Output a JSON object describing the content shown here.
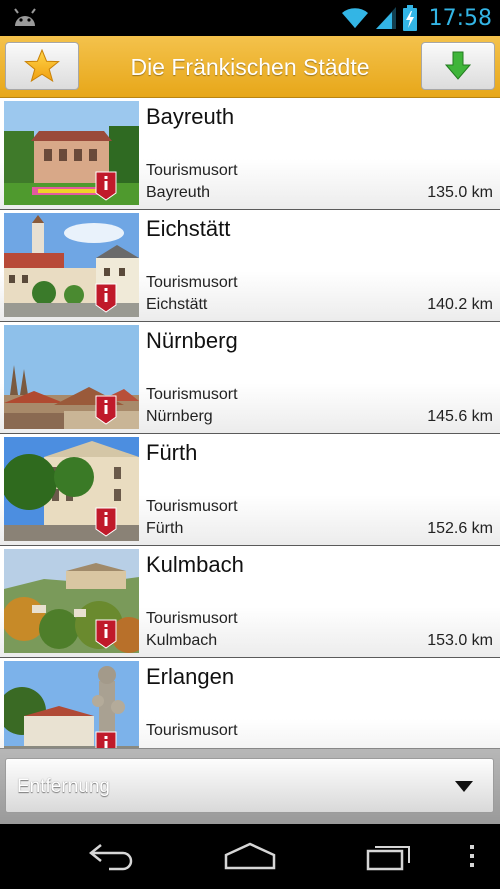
{
  "status_bar": {
    "time": "17:58",
    "icons": [
      "android-notification-icon",
      "wifi-icon",
      "signal-icon",
      "battery-charging-icon"
    ],
    "accent_color": "#33b5e5"
  },
  "action_bar": {
    "title": "Die Fränkischen Städte",
    "left_icon": "star-icon",
    "right_icon": "download-arrow-icon",
    "background_color": "#efb534"
  },
  "list": {
    "items": [
      {
        "name": "Bayreuth",
        "type": "Tourismusort",
        "city": "Bayreuth",
        "distance": "135.0 km",
        "thumb_icon": "bayreuth-photo"
      },
      {
        "name": "Eichstätt",
        "type": "Tourismusort",
        "city": "Eichstätt",
        "distance": "140.2 km",
        "thumb_icon": "eichstaett-photo"
      },
      {
        "name": "Nürnberg",
        "type": "Tourismusort",
        "city": "Nürnberg",
        "distance": "145.6 km",
        "thumb_icon": "nuernberg-photo"
      },
      {
        "name": "Fürth",
        "type": "Tourismusort",
        "city": "Fürth",
        "distance": "152.6 km",
        "thumb_icon": "fuerth-photo"
      },
      {
        "name": "Kulmbach",
        "type": "Tourismusort",
        "city": "Kulmbach",
        "distance": "153.0 km",
        "thumb_icon": "kulmbach-photo"
      },
      {
        "name": "Erlangen",
        "type": "Tourismusort",
        "city": "",
        "distance": "",
        "thumb_icon": "erlangen-photo"
      }
    ]
  },
  "sort": {
    "selected": "Entfernung"
  },
  "nav_bar": {
    "icons": [
      "back-icon",
      "home-icon",
      "recent-apps-icon",
      "menu-icon"
    ]
  }
}
